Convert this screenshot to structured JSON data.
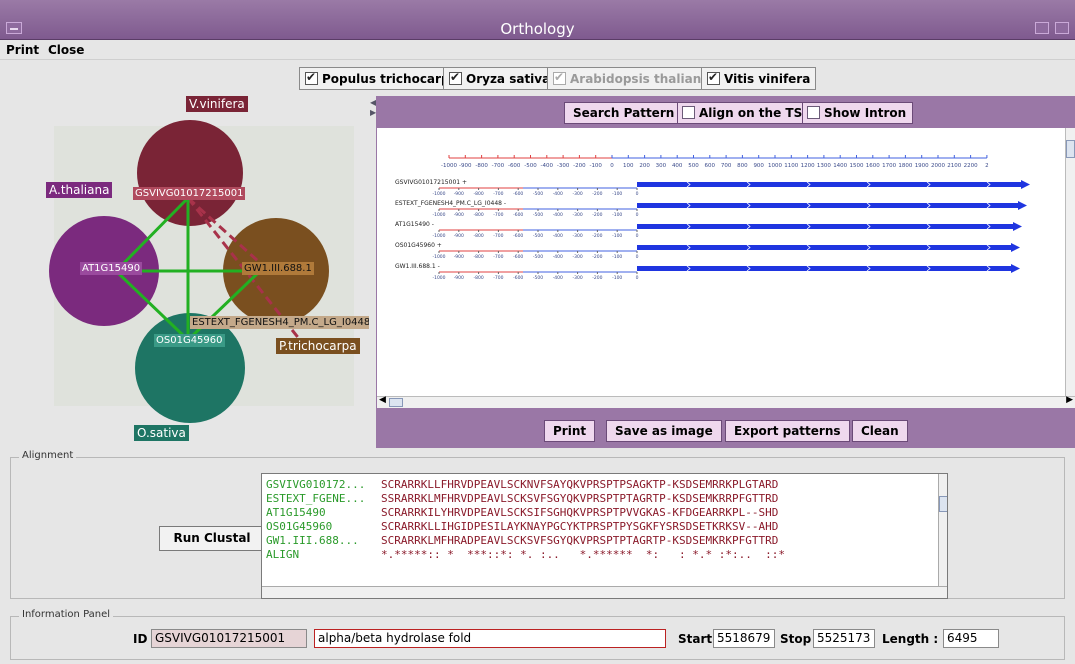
{
  "window": {
    "title": "Orthology"
  },
  "menu": {
    "items": [
      "Print",
      "Close"
    ]
  },
  "species": [
    {
      "label": "Populus trichocarpa",
      "checked": true,
      "enabled": true
    },
    {
      "label": "Oryza sativa",
      "checked": true,
      "enabled": true
    },
    {
      "label": "Arabidopsis thaliana",
      "checked": true,
      "enabled": false
    },
    {
      "label": "Vitis vinifera",
      "checked": true,
      "enabled": true
    }
  ],
  "graph": {
    "species_labels": {
      "vvinifera": "V.vinifera",
      "athaliana": "A.thaliana",
      "osativa": "O.sativa",
      "ptrichocarpa": "P.trichocarpa"
    },
    "gene_labels": {
      "vvinifera": "GSVIVG01017215001",
      "athaliana": "AT1G15490",
      "ptrichocarpa": "GW1.III.688.1",
      "ptrichocarpa_est": "ESTEXT_FGENESH4_PM.C_LG_I0448",
      "osativa": "OS01G45960"
    },
    "colors": {
      "vvinifera": "#7a2436",
      "athaliana": "#7b2a7e",
      "ptrichocarpa": "#7a4f1f",
      "osativa": "#1e7564",
      "edge": "#22b022",
      "edge_dashed": "#a8324a"
    }
  },
  "gene_panel": {
    "buttons": {
      "search_pattern": "Search Pattern",
      "align_tss": "Align on the TSS",
      "show_intron": "Show Intron"
    },
    "bottom_buttons": {
      "print": "Print",
      "save_image": "Save as image",
      "export_patterns": "Export patterns",
      "clean": "Clean"
    },
    "axis_ticks": [
      "-1000",
      "-900",
      "-800",
      "-700",
      "-600",
      "-500",
      "-400",
      "-300",
      "-200",
      "-100",
      "0",
      "100",
      "200",
      "300",
      "400",
      "500",
      "600",
      "700",
      "800",
      "900",
      "1000",
      "1100",
      "1200",
      "1300",
      "1400",
      "1500",
      "1600",
      "1700",
      "1800",
      "1900",
      "2000",
      "2100",
      "2200",
      "2"
    ],
    "mini_ticks": [
      "-1000",
      "-900",
      "-800",
      "-700",
      "-600",
      "-500",
      "-400",
      "-300",
      "-200",
      "-100",
      "0"
    ],
    "tracks": [
      {
        "name": "GSVIVG01017215001 +"
      },
      {
        "name": "ESTEXT_FGENESH4_PM.C_LG_I0448 -"
      },
      {
        "name": "AT1G15490 -"
      },
      {
        "name": "OS01G45960 +"
      },
      {
        "name": "GW1.III.688.1 -"
      }
    ]
  },
  "alignment": {
    "section_title": "Alignment",
    "run_clustal": "Run Clustal",
    "rows": [
      {
        "name": "GSVIVG010172...",
        "seq": "SCRARRKLLFHRVDPEAVLSCKNVFSAYQKVPRSPTPSAGKTP-KSDSEMRRKPLGTARD",
        "color": "#2a9a2a"
      },
      {
        "name": "ESTEXT_FGENE...",
        "seq": "SSRARRKLMFHRVDPEAVLSCKSVFSGYQKVPRSPTPTAGRTP-KSDSEMKRRPFGTTRD",
        "color": "#2a9a2a"
      },
      {
        "name": "AT1G15490",
        "seq": "SCRARRKILYHRVDPEAVLSCKSIFSGHQKVPRSPTPVVGKAS-KFDGEARRKPL--SHD",
        "color": "#2a9a2a"
      },
      {
        "name": "OS01G45960",
        "seq": "SCRARRKLLIHGIDPESILAYKNAYPGCYKTPRSPTPYSGKFYSRSDSETKRKSV--AHD",
        "color": "#2a9a2a"
      },
      {
        "name": "GW1.III.688...",
        "seq": "SCRARRKLMFHRADPEAVLSCKSVFSGYQKVPRSPTPTAGRTP-KSDSEMKRKPFGTTRD",
        "color": "#2a9a2a"
      },
      {
        "name": "ALIGN",
        "seq": "*.*****:: *  ***::*: *. :..   *.******  *:   : *.* :*:..  ::*",
        "color": "#2a9a2a"
      }
    ]
  },
  "info": {
    "section_title": "Information Panel",
    "id_label": "ID",
    "id_value": "GSVIVG01017215001",
    "description": "alpha/beta hydrolase fold",
    "start_label": "Start",
    "start_value": "5518679",
    "stop_label": "Stop",
    "stop_value": "5525173",
    "length_label": "Length :",
    "length_value": "6495"
  }
}
